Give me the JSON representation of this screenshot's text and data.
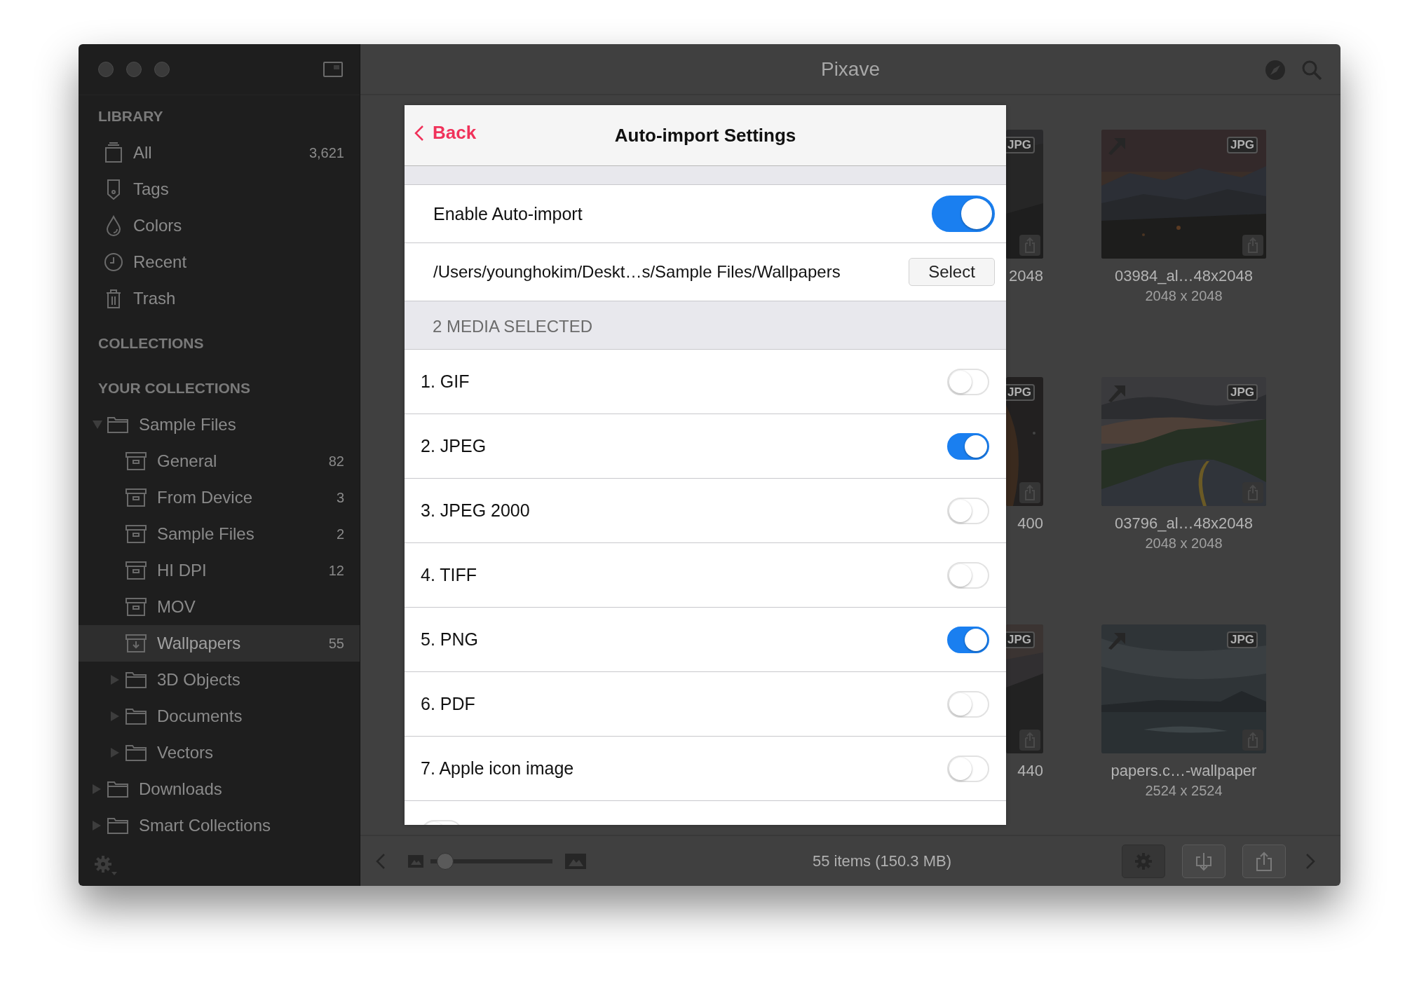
{
  "window": {
    "title": "Pixave"
  },
  "sidebar": {
    "library_header": "LIBRARY",
    "library": [
      {
        "label": "All",
        "count": "3,621"
      },
      {
        "label": "Tags"
      },
      {
        "label": "Colors"
      },
      {
        "label": "Recent"
      },
      {
        "label": "Trash"
      }
    ],
    "collections_header": "COLLECTIONS",
    "your_collections_header": "YOUR COLLECTIONS",
    "tree": [
      {
        "label": "Sample Files",
        "kind": "folder",
        "expanded": true,
        "selected": false,
        "children": [
          {
            "label": "General",
            "kind": "album",
            "count": "82",
            "selected": false
          },
          {
            "label": "From Device",
            "kind": "album",
            "count": "3",
            "selected": false
          },
          {
            "label": "Sample Files",
            "kind": "album",
            "count": "2",
            "selected": false
          },
          {
            "label": "HI DPI",
            "kind": "album",
            "count": "12",
            "selected": false
          },
          {
            "label": "MOV",
            "kind": "album",
            "selected": false
          },
          {
            "label": "Wallpapers",
            "kind": "import-album",
            "count": "55",
            "selected": true
          },
          {
            "label": "3D Objects",
            "kind": "folder",
            "expanded": false,
            "selected": false
          },
          {
            "label": "Documents",
            "kind": "folder",
            "expanded": false,
            "selected": false
          },
          {
            "label": "Vectors",
            "kind": "folder",
            "expanded": false,
            "selected": false
          }
        ]
      },
      {
        "label": "Downloads",
        "kind": "folder",
        "expanded": false,
        "selected": false
      },
      {
        "label": "Smart Collections",
        "kind": "folder",
        "expanded": false,
        "selected": false
      }
    ]
  },
  "thumbnails": [
    {
      "caption": "2048",
      "badge": "JPG"
    },
    {
      "caption": "03984_al…48x2048",
      "dimensions": "2048 x 2048",
      "badge": "JPG"
    },
    {
      "caption": "400",
      "badge": "JPG"
    },
    {
      "caption": "03796_al…48x2048",
      "dimensions": "2048 x 2048",
      "badge": "JPG"
    },
    {
      "caption": "440",
      "badge": "JPG"
    },
    {
      "caption": "papers.c…-wallpaper",
      "dimensions": "2524 x 2524",
      "badge": "JPG"
    }
  ],
  "status_bar": {
    "zoom": {
      "level": 0.05
    },
    "summary": "55 items (150.3 MB)"
  },
  "dialog": {
    "back": "Back",
    "title": "Auto-import Settings",
    "enable": {
      "label": "Enable Auto-import",
      "on": true
    },
    "folder": {
      "path": "/Users/younghokim/Deskt…s/Sample Files/Wallpapers",
      "button": "Select"
    },
    "section_header": "2 MEDIA SELECTED",
    "formats": [
      {
        "label": "1. GIF",
        "on": false
      },
      {
        "label": "2. JPEG",
        "on": true
      },
      {
        "label": "3. JPEG 2000",
        "on": false
      },
      {
        "label": "4. TIFF",
        "on": false
      },
      {
        "label": "5. PNG",
        "on": true
      },
      {
        "label": "6. PDF",
        "on": false
      },
      {
        "label": "7. Apple icon image",
        "on": false
      },
      {
        "on": false
      }
    ]
  }
}
